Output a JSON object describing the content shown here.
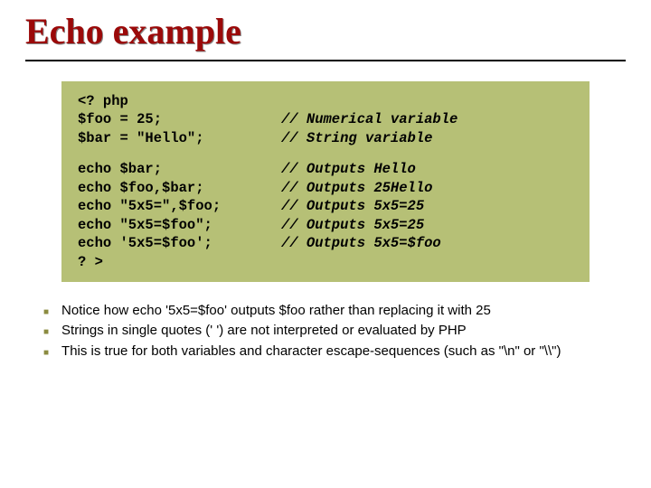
{
  "title": "Echo example",
  "code": {
    "l1a": "<? php",
    "l2a": "$foo = 25;",
    "l2b": "// Numerical variable",
    "l3a": "$bar = \"Hello\";",
    "l3b": "// String variable",
    "l4a": "echo $bar;",
    "l4b": "// Outputs Hello",
    "l5a": "echo $foo,$bar;",
    "l5b": "// Outputs 25Hello",
    "l6a": "echo \"5x5=\",$foo;",
    "l6b": "// Outputs 5x5=25",
    "l7a": "echo \"5x5=$foo\";",
    "l7b": "// Outputs 5x5=25",
    "l8a": "echo '5x5=$foo';",
    "l8b": "// Outputs 5x5=$foo",
    "l9a": "? >"
  },
  "notes": {
    "n1": "Notice how echo '5x5=$foo' outputs $foo rather than replacing it with 25",
    "n2": "Strings in single quotes (' ') are not interpreted or evaluated by PHP",
    "n3": "This is true for both variables and character escape-sequences (such as \"\\n\" or \"\\\\\")"
  }
}
